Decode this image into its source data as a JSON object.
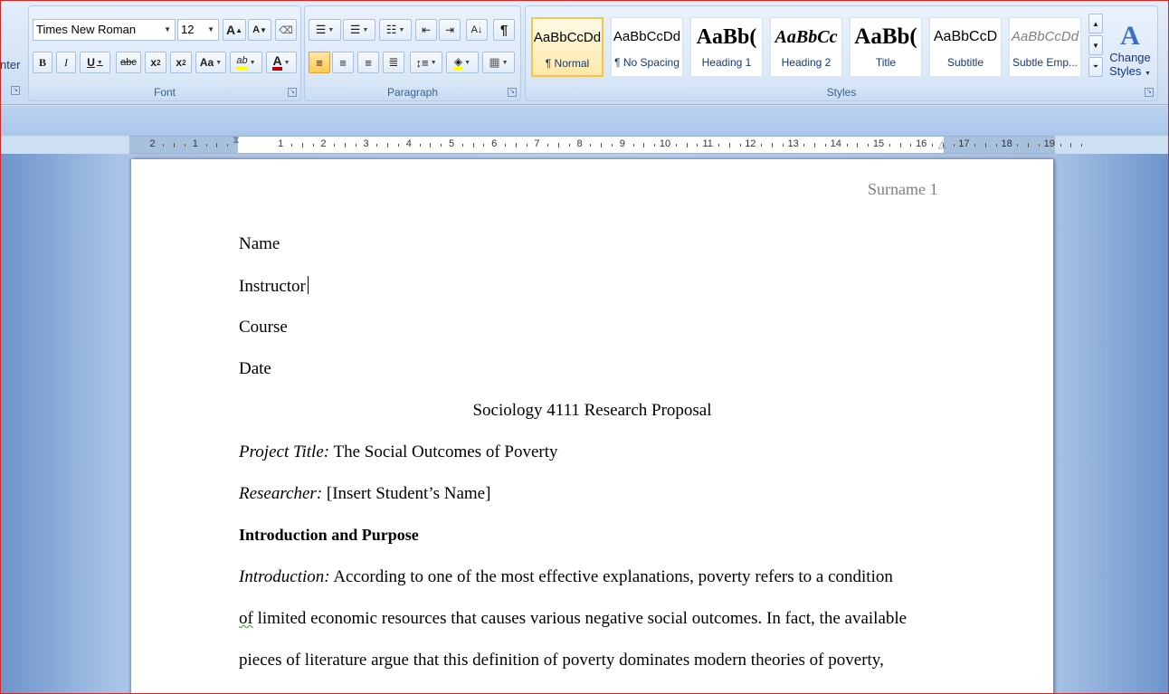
{
  "ribbon": {
    "left_clip": "nter",
    "font": {
      "label": "Font",
      "name": "Times New Roman",
      "size": "12",
      "grow_label": "A",
      "shrink_label": "A",
      "bold": "B",
      "italic": "I",
      "underline": "U",
      "strike": "abc",
      "subscript": "x",
      "superscript": "x",
      "change_case": "Aa",
      "highlight_label": "ab",
      "font_color_label": "A",
      "highlight_color": "#ffff00",
      "font_color": "#c00000"
    },
    "paragraph": {
      "label": "Paragraph",
      "show_marks": "¶"
    },
    "styles": {
      "label": "Styles",
      "items": [
        {
          "sample": "AaBbCcDd",
          "name": "¶ Normal"
        },
        {
          "sample": "AaBbCcDd",
          "name": "¶ No Spacing"
        },
        {
          "sample": "AaBb(",
          "name": "Heading 1"
        },
        {
          "sample": "AaBbCc",
          "name": "Heading 2"
        },
        {
          "sample": "AaBb(",
          "name": "Title"
        },
        {
          "sample": "AaBbCcD",
          "name": "Subtitle"
        },
        {
          "sample": "AaBbCcDd",
          "name": "Subtle Emp..."
        }
      ],
      "change_styles_line1": "Change",
      "change_styles_line2": "Styles"
    }
  },
  "ruler": {
    "numbers": [
      "2",
      "1",
      "1",
      "2",
      "3",
      "4",
      "5",
      "6",
      "7",
      "8",
      "9",
      "10",
      "11",
      "12",
      "13",
      "14",
      "15",
      "16",
      "17",
      "18",
      "19"
    ]
  },
  "document": {
    "header": "Surname 1",
    "lines": {
      "name": "Name",
      "instructor": "Instructor",
      "course": "Course",
      "date": "Date",
      "title": "Sociology 4111 Research Proposal",
      "project_label": "Project Title:",
      "project_value": " The Social Outcomes of Poverty",
      "researcher_label": "Researcher:",
      "researcher_value": " [Insert Student’s Name]",
      "section_heading": "Introduction  and  Purpose",
      "intro_label": "Introduction:",
      "intro_line1": " According to one of the most effective explanations, poverty refers to a condition",
      "intro_line2_word": "of",
      "intro_line2_rest": " limited economic resources that causes various negative social outcomes. In fact, the available",
      "intro_line3": "pieces of literature argue that this definition of poverty dominates modern theories of poverty,"
    }
  }
}
